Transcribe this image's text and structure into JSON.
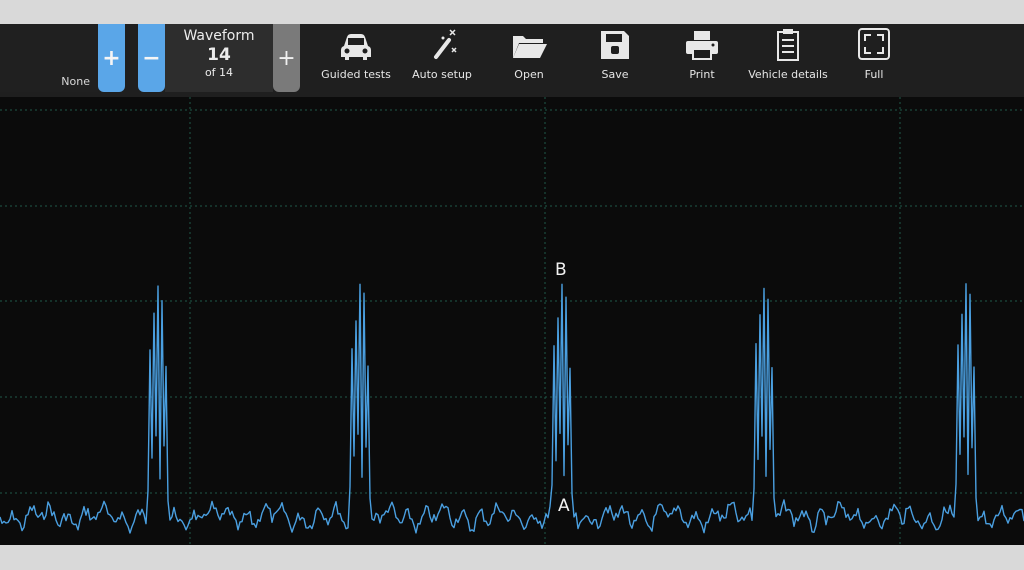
{
  "toolbar": {
    "channel": {
      "label": "None",
      "plus": "+"
    },
    "waveform": {
      "minus": "−",
      "title": "Waveform",
      "number": "14",
      "of_text": "of 14",
      "plus": "+"
    },
    "tools": [
      {
        "label": "Guided tests",
        "icon": "car-icon"
      },
      {
        "label": "Auto setup",
        "icon": "magic-wand-icon"
      },
      {
        "label": "Open",
        "icon": "folder-open-icon"
      },
      {
        "label": "Save",
        "icon": "save-icon"
      },
      {
        "label": "Print",
        "icon": "printer-icon"
      },
      {
        "label": "Vehicle details",
        "icon": "clipboard-icon"
      },
      {
        "label": "Full",
        "icon": "fullscreen-icon"
      }
    ]
  },
  "scope": {
    "markers": {
      "a": "A",
      "b": "B"
    },
    "trace_color": "#4a9fe0",
    "grid_color": "#1f5a4a",
    "background": "#0b0b0b"
  }
}
